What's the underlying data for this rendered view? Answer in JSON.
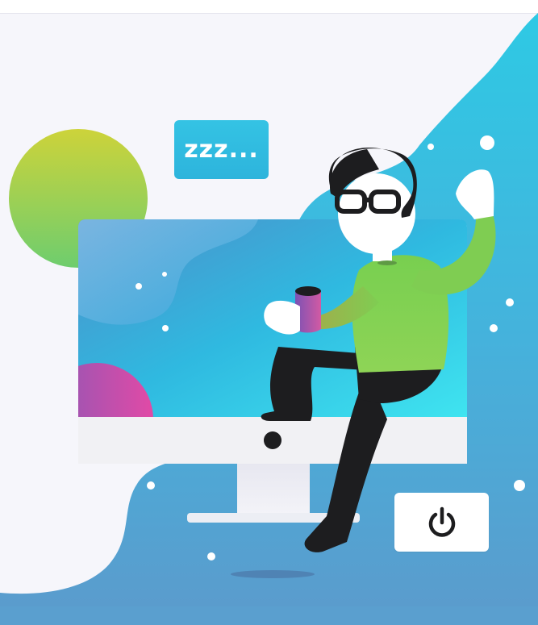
{
  "illustration": {
    "sleep_badge_text": "zzz...",
    "power_icon": "power-icon",
    "colors": {
      "background": "#f6f6fb",
      "wave_light": "#2ec6e2",
      "wave_dark": "#5a9fcf",
      "badge": "#2eb9de",
      "sweater": "#7fcd52",
      "pants": "#1d1d1f",
      "hair": "#1d1d1f",
      "screen_top": "#5d9cd0",
      "screen_bottom": "#35d6ec",
      "monitor_body": "#f1f1f4",
      "sun_top": "#c7d13c",
      "sun_bottom": "#74cf6a",
      "mug_top": "#9a4bb0",
      "mug_bottom": "#c65aa8"
    }
  }
}
